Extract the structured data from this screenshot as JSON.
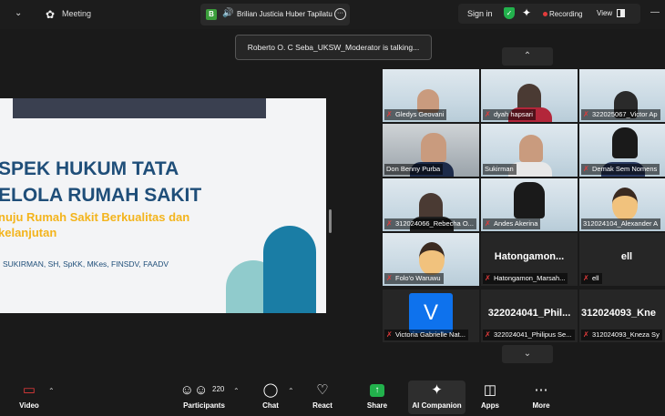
{
  "topbar": {
    "meeting_label": "Meeting",
    "speaker_name": "Brilian Justicia Huber Tapilatu",
    "sign_in": "Sign in",
    "recording": "Recording",
    "view": "View"
  },
  "toast": "Roberto O. C Seba_UKSW_Moderator is talking...",
  "slide": {
    "title_line1": "SPEK HUKUM TATA",
    "title_line2": "ELOLA RUMAH SAKIT",
    "subtitle_line1": "nuju Rumah Sakit Berkualitas dan",
    "subtitle_line2": "kelanjutan",
    "author": "SUKIRMAN, SH, SpKK, MKes, FINSDV, FAADV"
  },
  "gallery": {
    "tiles": [
      {
        "name": "Gledys Geovani"
      },
      {
        "name": "dyah hapsari"
      },
      {
        "name": "322025067_Victor Ap"
      },
      {
        "name": "Don Benny Purba"
      },
      {
        "name": "Sukirman"
      },
      {
        "name": "Demak Sem Nomens"
      },
      {
        "name": "312024066_Rebecha O..."
      },
      {
        "name": "Andes Akerina"
      },
      {
        "name": "312024104_Alexander A"
      },
      {
        "name": "Folo'o Waruwu"
      },
      {
        "name": "Hatongamon_Marsah...",
        "big": "Hatongamon..."
      },
      {
        "name": "ell",
        "big": "ell"
      },
      {
        "name": "Victoria Gabrielle Nat...",
        "avatar": "V"
      },
      {
        "name": "322024041_Philipus Se...",
        "big": "322024041_Phil..."
      },
      {
        "name": "312024093_Kneza Sy",
        "big": "312024093_Kne"
      }
    ]
  },
  "toolbar": {
    "video": "Video",
    "participants": "Participants",
    "participant_count": "220",
    "chat": "Chat",
    "react": "React",
    "share": "Share",
    "ai_companion": "AI Companion",
    "apps": "Apps",
    "more": "More"
  }
}
